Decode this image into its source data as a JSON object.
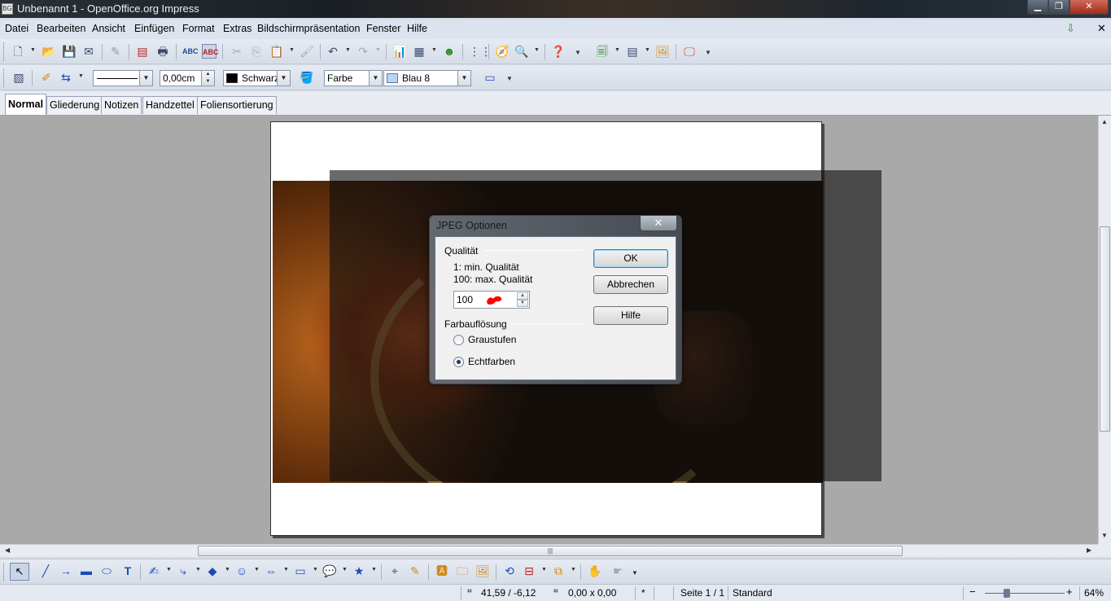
{
  "window": {
    "title": "Unbenannt 1 - OpenOffice.org Impress",
    "app_icon_glyph": "BG",
    "minimize_glyph": "▁",
    "maximize_glyph": "❐",
    "close_glyph": "✕"
  },
  "menubar": {
    "items": [
      "Datei",
      "Bearbeiten",
      "Ansicht",
      "Einfügen",
      "Format",
      "Extras",
      "Bildschirmpräsentation",
      "Fenster",
      "Hilfe"
    ],
    "close_glyph": "✕"
  },
  "toolbar2": {
    "line_width_value": "0,00cm",
    "line_color_value": "Schwarz",
    "area_style_value": "Farbe",
    "area_color_value": "Blau 8",
    "line_color_hex": "#000000",
    "area_color_hex": "#b8d4f0"
  },
  "tabs": [
    "Normal",
    "Gliederung",
    "Notizen",
    "Handzettel",
    "Foliensortierung"
  ],
  "active_tab": "Normal",
  "dialog": {
    "title": "JPEG Optionen",
    "close_glyph": "✕",
    "quality_group": "Qualität",
    "quality_min": "1: min. Qualität",
    "quality_max": "100: max. Qualität",
    "quality_value": "100",
    "color_group": "Farbauflösung",
    "option_grayscale": "Graustufen",
    "option_truecolor": "Echtfarben",
    "selected_option": "Echtfarben",
    "ok_label": "OK",
    "cancel_label": "Abbrechen",
    "help_label": "Hilfe"
  },
  "statusbar": {
    "position": "41,59 / -6,12",
    "size": "0,00 x 0,00",
    "modified": "*",
    "page": "Seite 1 / 1",
    "layout": "Standard",
    "zoom_minus": "−",
    "zoom_plus": "+",
    "zoom": "64%"
  },
  "scrollbars": {
    "up": "▲",
    "down": "▼",
    "left": "◀",
    "right": "▶",
    "grip": "|||"
  },
  "colors": {
    "accent": "#3c7fb1",
    "blot": "#ff0000"
  }
}
